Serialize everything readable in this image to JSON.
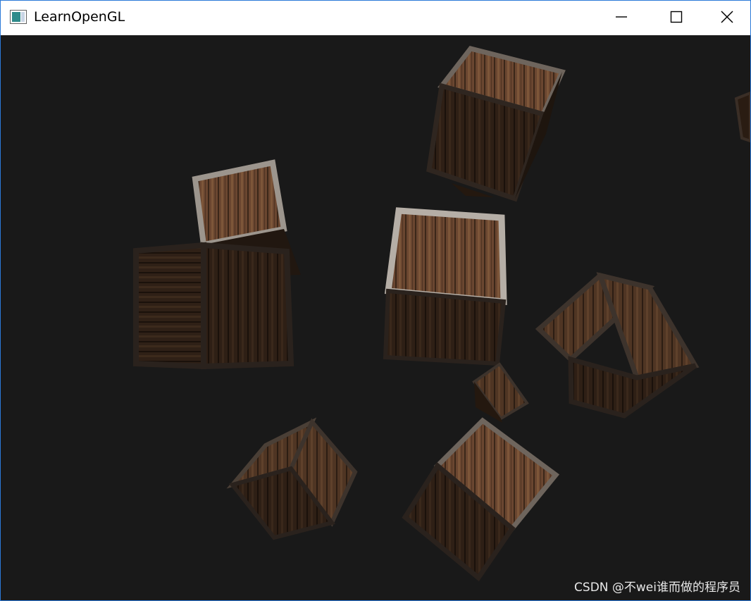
{
  "window": {
    "title": "LearnOpenGL",
    "app_icon": "opengl-app-icon",
    "controls": {
      "minimize_icon": "minimize-icon",
      "maximize_icon": "maximize-icon",
      "close_icon": "close-icon"
    }
  },
  "viewport": {
    "background_color": "#191919",
    "scene": "textured-wooden-crates",
    "crate_count": 10,
    "watermark": "CSDN @不wei谁而做的程序员"
  },
  "colors": {
    "wood_light": "#6e4b31",
    "wood_dark": "#2a1c12",
    "metal_frame": "#8a8580",
    "titlebar_bg": "#ffffff",
    "window_border": "#2b79d8"
  }
}
